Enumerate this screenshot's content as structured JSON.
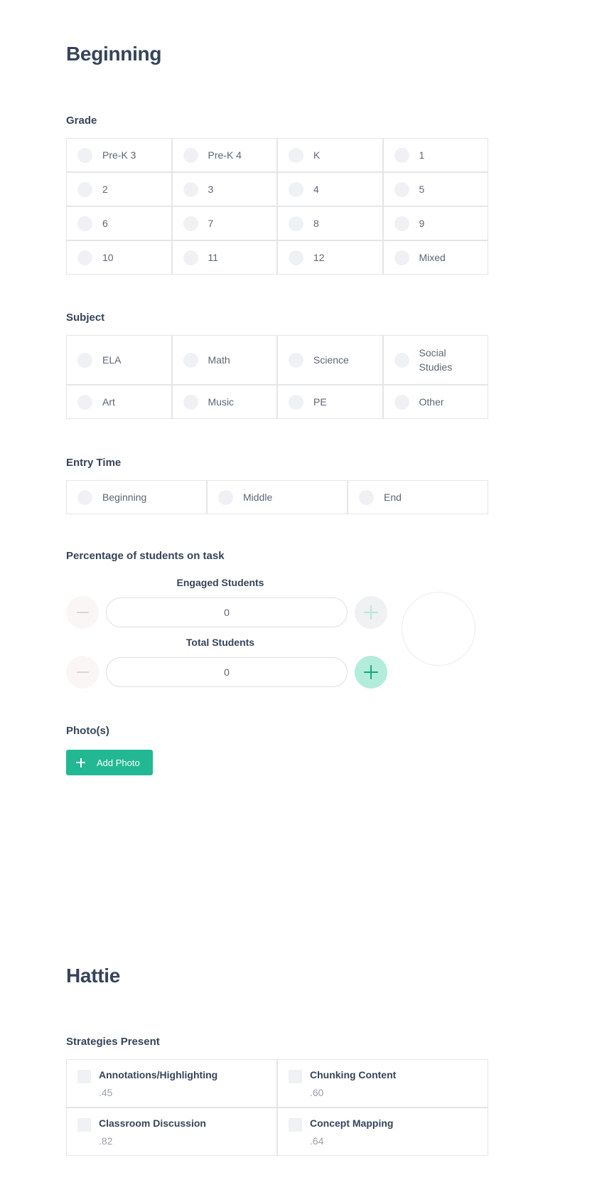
{
  "beginning": {
    "title": "Beginning",
    "grade": {
      "label": "Grade",
      "options": [
        "Pre-K 3",
        "Pre-K 4",
        "K",
        "1",
        "2",
        "3",
        "4",
        "5",
        "6",
        "7",
        "8",
        "9",
        "10",
        "11",
        "12",
        "Mixed"
      ]
    },
    "subject": {
      "label": "Subject",
      "options": [
        "ELA",
        "Math",
        "Science",
        "Social Studies",
        "Art",
        "Music",
        "PE",
        "Other"
      ]
    },
    "entry_time": {
      "label": "Entry Time",
      "options": [
        "Beginning",
        "Middle",
        "End"
      ]
    },
    "percentage": {
      "label": "Percentage of students on task",
      "engaged_label": "Engaged Students",
      "engaged_value": "0",
      "total_label": "Total Students",
      "total_value": "0",
      "minus_icon": "minus-icon",
      "plus_icon": "plus-icon"
    },
    "photos": {
      "label": "Photo(s)",
      "add_button": "Add Photo",
      "add_icon": "plus-icon"
    }
  },
  "hattie": {
    "title": "Hattie",
    "strategies": {
      "label": "Strategies Present",
      "items": [
        {
          "name": "Annotations/Highlighting",
          "value": ".45"
        },
        {
          "name": "Chunking Content",
          "value": ".60"
        },
        {
          "name": "Classroom Discussion",
          "value": ".82"
        },
        {
          "name": "Concept Mapping",
          "value": ".64"
        }
      ]
    }
  },
  "colors": {
    "heading": "#36445a",
    "accent_green": "#22b893",
    "mint": "#b4ecdc",
    "border": "#e3e5e8"
  }
}
